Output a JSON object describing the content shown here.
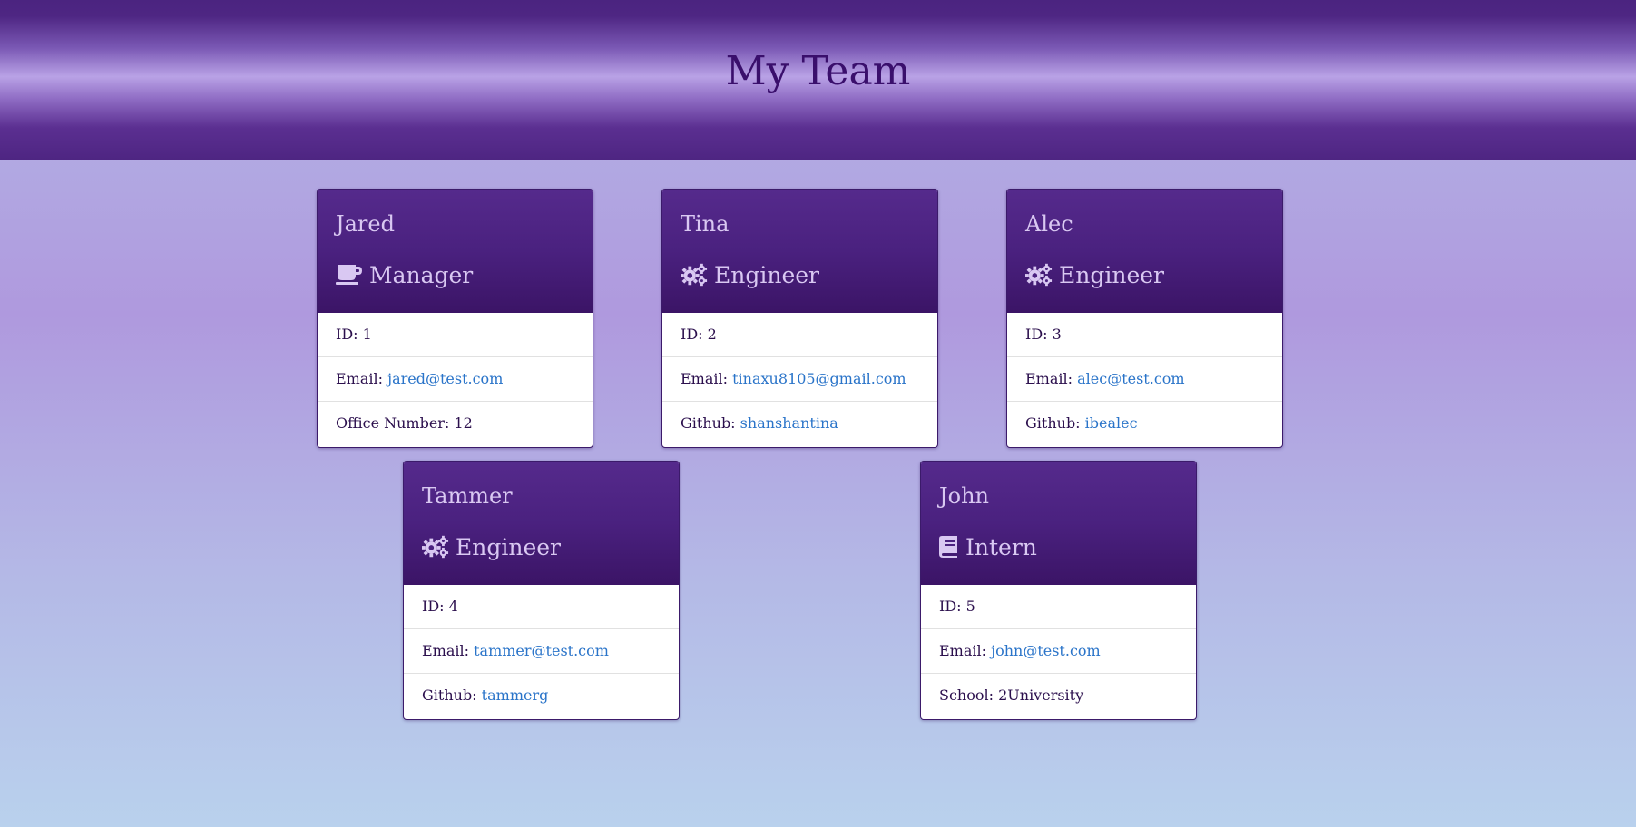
{
  "page": {
    "title": "My Team"
  },
  "colors": {
    "header_bg": "#4e2683",
    "title_color": "#3a0f6c",
    "card_header_bg": "#4a217f",
    "card_header_text": "#d9c8f2",
    "link": "#2a74c9"
  },
  "team": [
    {
      "name": "Jared",
      "role": "Manager",
      "icon": "coffee-icon",
      "id_label": "ID:",
      "id": "1",
      "email_label": "Email:",
      "email": "jared@test.com",
      "extra_label": "Office Number:",
      "extra": "12"
    },
    {
      "name": "Tina",
      "role": "Engineer",
      "icon": "gears-icon",
      "id_label": "ID:",
      "id": "2",
      "email_label": "Email:",
      "email": "tinaxu8105@gmail.com",
      "extra_label": "Github:",
      "extra": "shanshantina"
    },
    {
      "name": "Alec",
      "role": "Engineer",
      "icon": "gears-icon",
      "id_label": "ID:",
      "id": "3",
      "email_label": "Email:",
      "email": "alec@test.com",
      "extra_label": "Github:",
      "extra": "ibealec"
    },
    {
      "name": "Tammer",
      "role": "Engineer",
      "icon": "gears-icon",
      "id_label": "ID:",
      "id": "4",
      "email_label": "Email:",
      "email": "tammer@test.com",
      "extra_label": "Github:",
      "extra": "tammerg"
    },
    {
      "name": "John",
      "role": "Intern",
      "icon": "book-icon",
      "id_label": "ID:",
      "id": "5",
      "email_label": "Email:",
      "email": "john@test.com",
      "extra_label": "School:",
      "extra": "2University"
    }
  ]
}
